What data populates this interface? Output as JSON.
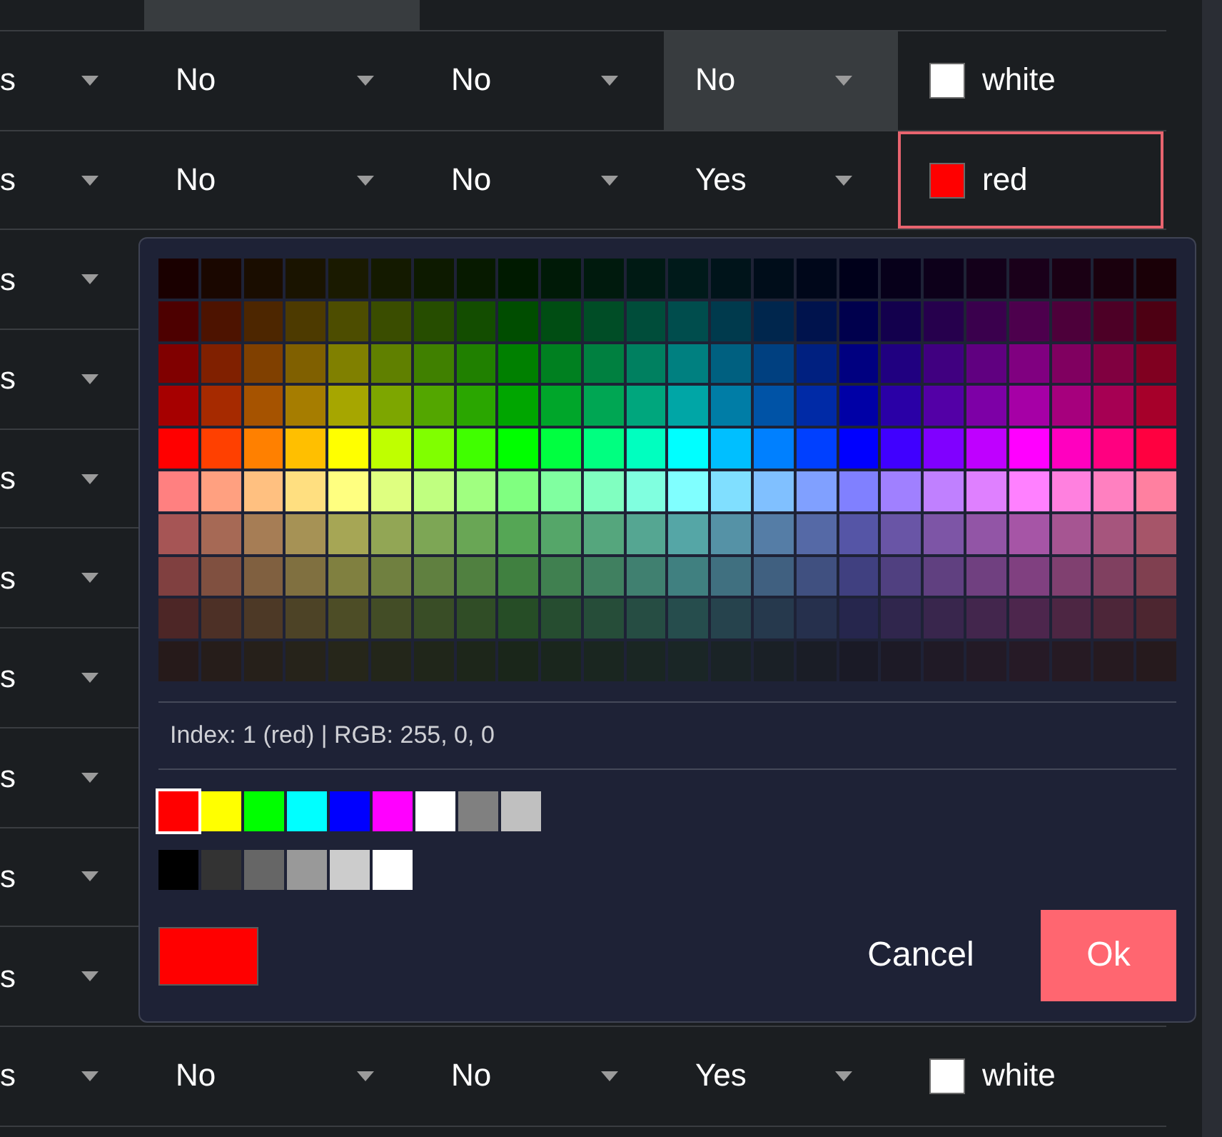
{
  "table": {
    "rows": [
      {
        "cut_off": true,
        "cells": [
          {
            "kind": "dropdown",
            "highlighted": false
          },
          {
            "kind": "dropdown",
            "highlighted": true
          },
          {
            "kind": "dropdown",
            "highlighted": false
          },
          {
            "kind": "dropdown",
            "highlighted": false
          }
        ]
      },
      {
        "cut_off": false,
        "cells": [
          {
            "kind": "dropdown",
            "value": "s",
            "highlighted": false
          },
          {
            "kind": "dropdown",
            "value": "No",
            "highlighted": false
          },
          {
            "kind": "dropdown",
            "value": "No",
            "highlighted": false
          },
          {
            "kind": "dropdown",
            "value": "No",
            "highlighted": true
          },
          {
            "kind": "color",
            "value": "white",
            "color": "#ffffff",
            "selected": false
          }
        ]
      },
      {
        "cut_off": false,
        "cells": [
          {
            "kind": "dropdown",
            "value": "s",
            "highlighted": false
          },
          {
            "kind": "dropdown",
            "value": "No",
            "highlighted": false
          },
          {
            "kind": "dropdown",
            "value": "No",
            "highlighted": false
          },
          {
            "kind": "dropdown",
            "value": "Yes",
            "highlighted": false
          },
          {
            "kind": "color",
            "value": "red",
            "color": "#ff0000",
            "selected": true
          }
        ]
      },
      {
        "cut_off": false,
        "cells": [
          {
            "kind": "dropdown",
            "value": "s",
            "highlighted": false
          }
        ]
      },
      {
        "cut_off": false,
        "cells": [
          {
            "kind": "dropdown",
            "value": "s",
            "highlighted": false
          }
        ]
      },
      {
        "cut_off": false,
        "cells": [
          {
            "kind": "dropdown",
            "value": "s",
            "highlighted": false
          }
        ]
      },
      {
        "cut_off": false,
        "cells": [
          {
            "kind": "dropdown",
            "value": "s",
            "highlighted": false
          }
        ]
      },
      {
        "cut_off": false,
        "cells": [
          {
            "kind": "dropdown",
            "value": "s",
            "highlighted": false
          }
        ]
      },
      {
        "cut_off": false,
        "cells": [
          {
            "kind": "dropdown",
            "value": "s",
            "highlighted": false
          }
        ]
      },
      {
        "cut_off": false,
        "cells": [
          {
            "kind": "dropdown",
            "value": "s",
            "highlighted": false
          }
        ]
      },
      {
        "cut_off": false,
        "cells": [
          {
            "kind": "dropdown",
            "value": "s",
            "highlighted": false
          }
        ]
      },
      {
        "cut_off": false,
        "cells": [
          {
            "kind": "dropdown",
            "value": "s",
            "highlighted": false
          },
          {
            "kind": "dropdown",
            "value": "No",
            "highlighted": false
          },
          {
            "kind": "dropdown",
            "value": "No",
            "highlighted": false
          },
          {
            "kind": "dropdown",
            "value": "Yes",
            "highlighted": false
          },
          {
            "kind": "color",
            "value": "white",
            "color": "#ffffff",
            "selected": false
          }
        ]
      }
    ]
  },
  "color_picker": {
    "palette": [
      [
        {
          "color": "#1a0000"
        },
        {
          "color": "#1a0700"
        },
        {
          "color": "#1a0d00"
        },
        {
          "color": "#1a1400"
        },
        {
          "color": "#1a1a00"
        },
        {
          "color": "#141a00"
        },
        {
          "color": "#0d1a00"
        },
        {
          "color": "#071a00"
        },
        {
          "color": "#001a00"
        },
        {
          "color": "#001a07"
        },
        {
          "color": "#001a0d"
        },
        {
          "color": "#001a14"
        },
        {
          "color": "#001a1a"
        },
        {
          "color": "#00141a"
        },
        {
          "color": "#000d1a"
        },
        {
          "color": "#00071a"
        },
        {
          "color": "#00001a"
        },
        {
          "color": "#07001a"
        },
        {
          "color": "#0d001a"
        },
        {
          "color": "#14001a"
        },
        {
          "color": "#1a001a"
        },
        {
          "color": "#1a0014"
        },
        {
          "color": "#1a000d"
        },
        {
          "color": "#1a0007"
        }
      ],
      [
        {
          "color": "#4d0000"
        },
        {
          "color": "#4d1300"
        },
        {
          "color": "#4d2600"
        },
        {
          "color": "#4d3a00"
        },
        {
          "color": "#4d4d00"
        },
        {
          "color": "#3a4d00"
        },
        {
          "color": "#264d00"
        },
        {
          "color": "#134d00"
        },
        {
          "color": "#004d00"
        },
        {
          "color": "#004d13"
        },
        {
          "color": "#004d26"
        },
        {
          "color": "#004d3a"
        },
        {
          "color": "#004d4d"
        },
        {
          "color": "#003a4d"
        },
        {
          "color": "#00264d"
        },
        {
          "color": "#00134d"
        },
        {
          "color": "#00004d"
        },
        {
          "color": "#13004d"
        },
        {
          "color": "#26004d"
        },
        {
          "color": "#3a004d"
        },
        {
          "color": "#4d004d"
        },
        {
          "color": "#4d003a"
        },
        {
          "color": "#4d0026"
        },
        {
          "color": "#4d0013"
        }
      ],
      [
        {
          "color": "#800000"
        },
        {
          "color": "#802000"
        },
        {
          "color": "#804000"
        },
        {
          "color": "#806000"
        },
        {
          "color": "#808000"
        },
        {
          "color": "#608000"
        },
        {
          "color": "#408000"
        },
        {
          "color": "#208000"
        },
        {
          "color": "#008000"
        },
        {
          "color": "#008020"
        },
        {
          "color": "#008040"
        },
        {
          "color": "#008060"
        },
        {
          "color": "#008080"
        },
        {
          "color": "#006080"
        },
        {
          "color": "#004080"
        },
        {
          "color": "#002080"
        },
        {
          "color": "#000080"
        },
        {
          "color": "#200080"
        },
        {
          "color": "#400080"
        },
        {
          "color": "#600080"
        },
        {
          "color": "#800080"
        },
        {
          "color": "#800060"
        },
        {
          "color": "#800040"
        },
        {
          "color": "#800020"
        }
      ],
      [
        {
          "color": "#a60000"
        },
        {
          "color": "#a62a00"
        },
        {
          "color": "#a65300"
        },
        {
          "color": "#a67d00"
        },
        {
          "color": "#a6a600"
        },
        {
          "color": "#7da600"
        },
        {
          "color": "#53a600"
        },
        {
          "color": "#2aa600"
        },
        {
          "color": "#00a600"
        },
        {
          "color": "#00a62a"
        },
        {
          "color": "#00a653"
        },
        {
          "color": "#00a67d"
        },
        {
          "color": "#00a6a6"
        },
        {
          "color": "#007da6"
        },
        {
          "color": "#0053a6"
        },
        {
          "color": "#002aa6"
        },
        {
          "color": "#0000a6"
        },
        {
          "color": "#2a00a6"
        },
        {
          "color": "#5300a6"
        },
        {
          "color": "#7d00a6"
        },
        {
          "color": "#a600a6"
        },
        {
          "color": "#a6007d"
        },
        {
          "color": "#a60053"
        },
        {
          "color": "#a6002a"
        }
      ],
      [
        {
          "color": "#ff0000"
        },
        {
          "color": "#ff4000"
        },
        {
          "color": "#ff8000"
        },
        {
          "color": "#ffbf00"
        },
        {
          "color": "#ffff00"
        },
        {
          "color": "#bfff00"
        },
        {
          "color": "#80ff00"
        },
        {
          "color": "#40ff00"
        },
        {
          "color": "#00ff00"
        },
        {
          "color": "#00ff40"
        },
        {
          "color": "#00ff80"
        },
        {
          "color": "#00ffbf"
        },
        {
          "color": "#00ffff"
        },
        {
          "color": "#00bfff"
        },
        {
          "color": "#0080ff"
        },
        {
          "color": "#0040ff"
        },
        {
          "color": "#0000ff"
        },
        {
          "color": "#4000ff"
        },
        {
          "color": "#8000ff"
        },
        {
          "color": "#bf00ff"
        },
        {
          "color": "#ff00ff"
        },
        {
          "color": "#ff00bf"
        },
        {
          "color": "#ff0080"
        },
        {
          "color": "#ff0040"
        }
      ],
      [
        {
          "color": "#ff8080"
        },
        {
          "color": "#ffa080"
        },
        {
          "color": "#ffc080"
        },
        {
          "color": "#ffdf80"
        },
        {
          "color": "#ffff80"
        },
        {
          "color": "#dfff80"
        },
        {
          "color": "#c0ff80"
        },
        {
          "color": "#a0ff80"
        },
        {
          "color": "#80ff80"
        },
        {
          "color": "#80ffa0"
        },
        {
          "color": "#80ffc0"
        },
        {
          "color": "#80ffdf"
        },
        {
          "color": "#80ffff"
        },
        {
          "color": "#80dfff"
        },
        {
          "color": "#80c0ff"
        },
        {
          "color": "#80a0ff"
        },
        {
          "color": "#8080ff"
        },
        {
          "color": "#a080ff"
        },
        {
          "color": "#c080ff"
        },
        {
          "color": "#df80ff"
        },
        {
          "color": "#ff80ff"
        },
        {
          "color": "#ff80df"
        },
        {
          "color": "#ff80c0"
        },
        {
          "color": "#ff80a0"
        }
      ],
      [
        {
          "color": "#a65555"
        },
        {
          "color": "#a66955"
        },
        {
          "color": "#a67d55"
        },
        {
          "color": "#a69255"
        },
        {
          "color": "#a6a655"
        },
        {
          "color": "#92a655"
        },
        {
          "color": "#7da655"
        },
        {
          "color": "#69a655"
        },
        {
          "color": "#55a655"
        },
        {
          "color": "#55a669"
        },
        {
          "color": "#55a67d"
        },
        {
          "color": "#55a692"
        },
        {
          "color": "#55a6a6"
        },
        {
          "color": "#5592a6"
        },
        {
          "color": "#557da6"
        },
        {
          "color": "#5569a6"
        },
        {
          "color": "#5555a6"
        },
        {
          "color": "#6955a6"
        },
        {
          "color": "#7d55a6"
        },
        {
          "color": "#9255a6"
        },
        {
          "color": "#a655a6"
        },
        {
          "color": "#a65592"
        },
        {
          "color": "#a6557d"
        },
        {
          "color": "#a65569"
        }
      ],
      [
        {
          "color": "#804040"
        },
        {
          "color": "#805040"
        },
        {
          "color": "#806040"
        },
        {
          "color": "#807040"
        },
        {
          "color": "#808040"
        },
        {
          "color": "#708040"
        },
        {
          "color": "#608040"
        },
        {
          "color": "#508040"
        },
        {
          "color": "#408040"
        },
        {
          "color": "#408050"
        },
        {
          "color": "#408060"
        },
        {
          "color": "#408070"
        },
        {
          "color": "#408080"
        },
        {
          "color": "#407080"
        },
        {
          "color": "#406080"
        },
        {
          "color": "#405080"
        },
        {
          "color": "#404080"
        },
        {
          "color": "#504080"
        },
        {
          "color": "#604080"
        },
        {
          "color": "#704080"
        },
        {
          "color": "#804080"
        },
        {
          "color": "#804070"
        },
        {
          "color": "#804060"
        },
        {
          "color": "#804050"
        }
      ],
      [
        {
          "color": "#4d2626"
        },
        {
          "color": "#4d3026"
        },
        {
          "color": "#4d3926"
        },
        {
          "color": "#4d4326"
        },
        {
          "color": "#4d4d26"
        },
        {
          "color": "#434d26"
        },
        {
          "color": "#394d26"
        },
        {
          "color": "#304d26"
        },
        {
          "color": "#264d26"
        },
        {
          "color": "#264d30"
        },
        {
          "color": "#264d39"
        },
        {
          "color": "#264d43"
        },
        {
          "color": "#264d4d"
        },
        {
          "color": "#26434d"
        },
        {
          "color": "#26394d"
        },
        {
          "color": "#26304d"
        },
        {
          "color": "#26264d"
        },
        {
          "color": "#30264d"
        },
        {
          "color": "#39264d"
        },
        {
          "color": "#43264d"
        },
        {
          "color": "#4d264d"
        },
        {
          "color": "#4d2643"
        },
        {
          "color": "#4d2639"
        },
        {
          "color": "#4d2630"
        }
      ],
      [
        {
          "color": "#261a1a"
        },
        {
          "color": "#261d1a"
        },
        {
          "color": "#26201a"
        },
        {
          "color": "#26231a"
        },
        {
          "color": "#26261a"
        },
        {
          "color": "#23261a"
        },
        {
          "color": "#20261a"
        },
        {
          "color": "#1d261a"
        },
        {
          "color": "#1a261a"
        },
        {
          "color": "#1a261d"
        },
        {
          "color": "#1a2620"
        },
        {
          "color": "#1a2623"
        },
        {
          "color": "#1a2626"
        },
        {
          "color": "#1a2326"
        },
        {
          "color": "#1a2026"
        },
        {
          "color": "#1a1d26"
        },
        {
          "color": "#1a1a26"
        },
        {
          "color": "#1d1a26"
        },
        {
          "color": "#201a26"
        },
        {
          "color": "#231a26"
        },
        {
          "color": "#261a26"
        },
        {
          "color": "#261a23"
        },
        {
          "color": "#261a20"
        },
        {
          "color": "#261a1d"
        }
      ]
    ],
    "info": "Index: 1 (red) | RGB: 255, 0, 0",
    "quick_colors": [
      [
        {
          "color": "#ff0000",
          "selected": true
        },
        {
          "color": "#ffff00",
          "selected": false
        },
        {
          "color": "#00ff00",
          "selected": false
        },
        {
          "color": "#00ffff",
          "selected": false
        },
        {
          "color": "#0000ff",
          "selected": false
        },
        {
          "color": "#ff00ff",
          "selected": false
        },
        {
          "color": "#ffffff",
          "selected": false
        },
        {
          "color": "#808080",
          "selected": false
        },
        {
          "color": "#c0c0c0",
          "selected": false
        }
      ],
      [
        {
          "color": "#000000",
          "selected": false
        },
        {
          "color": "#333333",
          "selected": false
        },
        {
          "color": "#666666",
          "selected": false
        },
        {
          "color": "#999999",
          "selected": false
        },
        {
          "color": "#cccccc",
          "selected": false
        },
        {
          "color": "#ffffff",
          "selected": false
        }
      ]
    ],
    "preview": {
      "color": "#ff0000"
    },
    "buttons": [
      {
        "label": "Cancel",
        "kind": "cancel"
      },
      {
        "label": "Ok",
        "kind": "confirm"
      }
    ]
  }
}
